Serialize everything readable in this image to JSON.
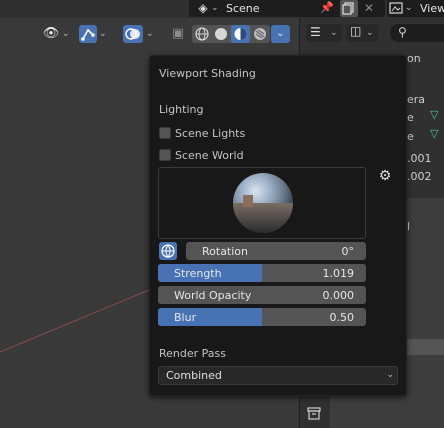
{
  "topbar": {
    "scene_name": "Scene",
    "view_label": "View"
  },
  "viewport_header": {
    "shading_modes": [
      "wireframe",
      "solid",
      "material-preview",
      "rendered"
    ],
    "active_mode": "material-preview"
  },
  "outliner": {
    "row_texts": [
      "on",
      "era",
      "e",
      "e",
      ".001",
      ".002"
    ]
  },
  "properties": {
    "partial_text": "l"
  },
  "popover": {
    "title": "Viewport Shading",
    "lighting_label": "Lighting",
    "scene_lights_label": "Scene Lights",
    "scene_world_label": "Scene World",
    "rotation_label": "Rotation",
    "rotation_value": "0°",
    "strength_label": "Strength",
    "strength_value": "1.019",
    "strength_fill": 0.5,
    "world_opacity_label": "World Opacity",
    "world_opacity_value": "0.000",
    "blur_label": "Blur",
    "blur_value": "0.50",
    "blur_fill": 0.5,
    "render_pass_label": "Render Pass",
    "render_pass_value": "Combined"
  },
  "colors": {
    "accent": "#4772b3",
    "panel": "#181818",
    "field": "#545454",
    "outliner_green": "#3bcf9b"
  }
}
